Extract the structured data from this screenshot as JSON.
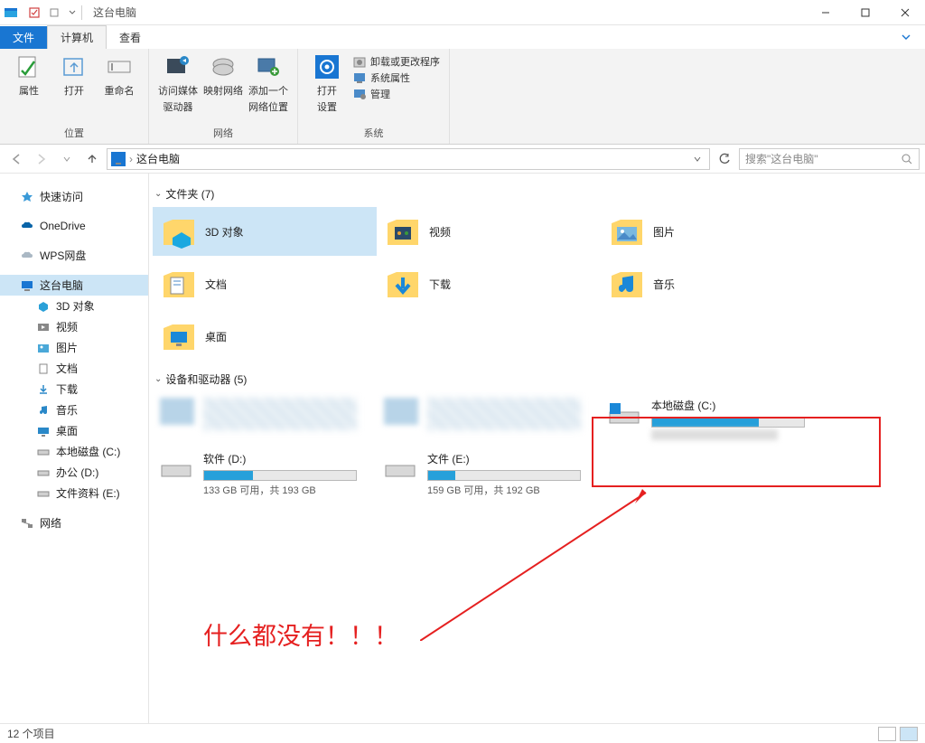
{
  "titlebar": {
    "title": "这台电脑"
  },
  "tabs": {
    "file": "文件",
    "computer": "计算机",
    "view": "查看"
  },
  "ribbon": {
    "group1": {
      "label": "位置",
      "properties": "属性",
      "open": "打开",
      "rename": "重命名"
    },
    "group2": {
      "label": "网络",
      "access_media": "访问媒体",
      "media_sub": "驱动器",
      "map_network": "映射网络",
      "add_network": "添加一个",
      "add_network_sub": "网络位置"
    },
    "group3": {
      "label": "系统",
      "open_settings": "打开",
      "open_settings_sub": "设置",
      "uninstall": "卸载或更改程序",
      "sys_props": "系统属性",
      "manage": "管理"
    }
  },
  "address": {
    "path": "这台电脑"
  },
  "search": {
    "placeholder": "搜索\"这台电脑\""
  },
  "sidebar": {
    "quick_access": "快速访问",
    "onedrive": "OneDrive",
    "wps": "WPS网盘",
    "this_pc": "这台电脑",
    "items": [
      {
        "label": "3D 对象"
      },
      {
        "label": "视频"
      },
      {
        "label": "图片"
      },
      {
        "label": "文档"
      },
      {
        "label": "下载"
      },
      {
        "label": "音乐"
      },
      {
        "label": "桌面"
      },
      {
        "label": "本地磁盘 (C:)"
      },
      {
        "label": "办公 (D:)"
      },
      {
        "label": "文件资料 (E:)"
      }
    ],
    "network": "网络"
  },
  "sections": {
    "folders_header": "文件夹 (7)",
    "devices_header": "设备和驱动器 (5)"
  },
  "folders": [
    {
      "label": "3D 对象"
    },
    {
      "label": "视频"
    },
    {
      "label": "图片"
    },
    {
      "label": "文档"
    },
    {
      "label": "下载"
    },
    {
      "label": "音乐"
    },
    {
      "label": "桌面"
    }
  ],
  "drives": [
    {
      "label": "本地磁盘 (C:)",
      "sub": "",
      "fill_pct": 70
    },
    {
      "label": "软件 (D:)",
      "sub": "133 GB 可用，共 193 GB",
      "fill_pct": 32
    },
    {
      "label": "文件 (E:)",
      "sub": "159 GB 可用，共 192 GB",
      "fill_pct": 18
    }
  ],
  "annotation": {
    "text": "什么都没有！！！"
  },
  "status": {
    "items": "12 个项目"
  }
}
